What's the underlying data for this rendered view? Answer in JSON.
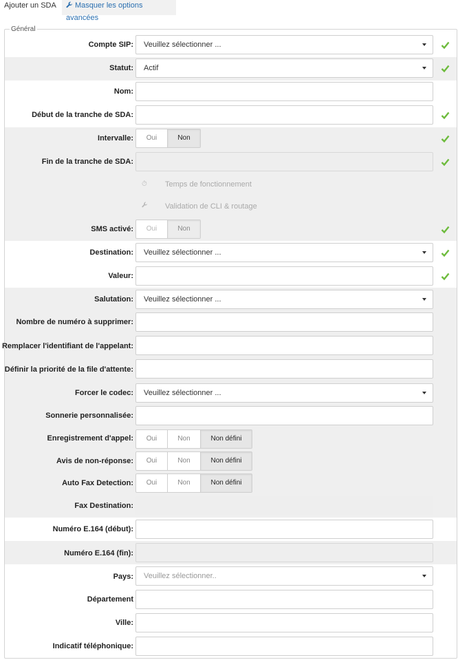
{
  "tabs": {
    "active": "Ajouter un SDA",
    "toggle_advanced": "Masquer les options avancées"
  },
  "legend": "Général",
  "colors": {
    "check": "#6dbb3c",
    "link": "#2a6fb0",
    "band": "#efefef"
  },
  "fields": {
    "compte_sip": {
      "label": "Compte SIP:",
      "value": "Veuillez sélectionner ..."
    },
    "statut": {
      "label": "Statut:",
      "value": "Actif"
    },
    "nom": {
      "label": "Nom:",
      "value": ""
    },
    "debut_tranche": {
      "label": "Début de la tranche de SDA:",
      "value": ""
    },
    "intervalle": {
      "label": "Intervalle:",
      "options": [
        "Oui",
        "Non"
      ],
      "selected": "Non"
    },
    "fin_tranche": {
      "label": "Fin de la tranche de SDA:",
      "value": ""
    },
    "temps_btn": {
      "label": "Temps de fonctionnement",
      "icon": "clock-icon"
    },
    "validation_btn": {
      "label": "Validation de CLI & routage",
      "icon": "wrench-icon"
    },
    "sms": {
      "label": "SMS activé:",
      "options": [
        "Oui",
        "Non"
      ],
      "selected": "Non"
    },
    "destination": {
      "label": "Destination:",
      "value": "Veuillez sélectionner ..."
    },
    "valeur": {
      "label": "Valeur:",
      "value": ""
    },
    "salutation": {
      "label": "Salutation:",
      "value": "Veuillez sélectionner ..."
    },
    "nb_supprimer": {
      "label": "Nombre de numéro à supprimer:",
      "value": ""
    },
    "remplacer_id": {
      "label": "Remplacer l'identifiant de l'appelant:",
      "value": ""
    },
    "priorite": {
      "label": "Définir la priorité de la file d'attente:",
      "value": ""
    },
    "codec": {
      "label": "Forcer le codec:",
      "value": "Veuillez sélectionner ..."
    },
    "sonnerie": {
      "label": "Sonnerie personnalisée:",
      "value": ""
    },
    "enregistrement": {
      "label": "Enregistrement d'appel:",
      "options": [
        "Oui",
        "Non",
        "Non défini"
      ],
      "selected": "Non défini"
    },
    "avis": {
      "label": "Avis de non-réponse:",
      "options": [
        "Oui",
        "Non",
        "Non défini"
      ],
      "selected": "Non défini"
    },
    "autofax": {
      "label": "Auto Fax Detection:",
      "options": [
        "Oui",
        "Non",
        "Non défini"
      ],
      "selected": "Non défini"
    },
    "fax_dest": {
      "label": "Fax Destination:",
      "value": ""
    },
    "e164_debut": {
      "label": "Numéro E.164 (début):",
      "value": ""
    },
    "e164_fin": {
      "label": "Numéro E.164 (fin):",
      "value": ""
    },
    "pays": {
      "label": "Pays:",
      "placeholder": "Veuillez sélectionner.."
    },
    "departement": {
      "label": "Département",
      "value": ""
    },
    "ville": {
      "label": "Ville:",
      "value": ""
    },
    "indicatif": {
      "label": "Indicatif téléphonique:",
      "value": ""
    }
  }
}
